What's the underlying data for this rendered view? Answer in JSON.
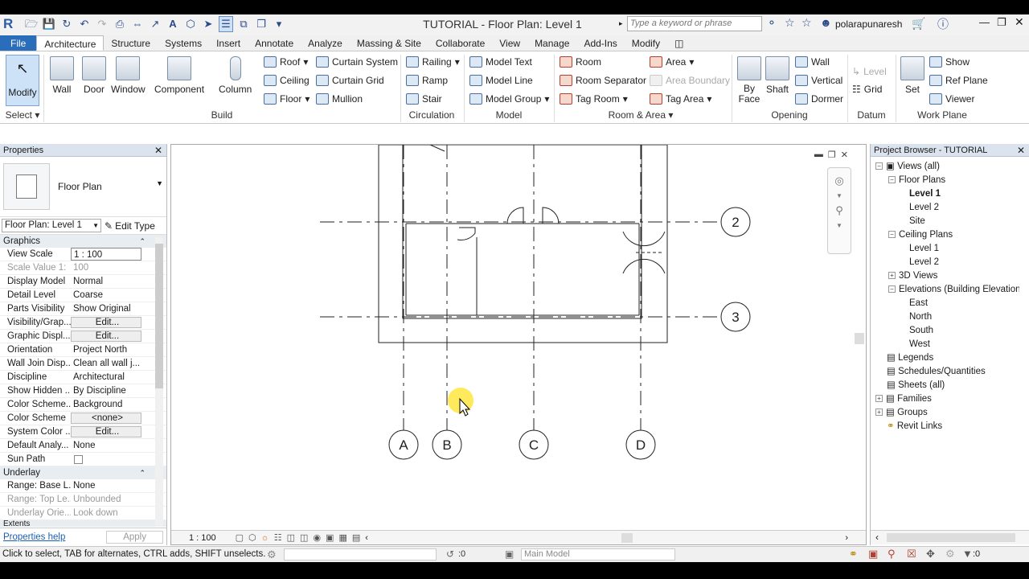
{
  "app": {
    "title": "TUTORIAL - Floor Plan: Level 1",
    "search_placeholder": "Type a keyword or phrase",
    "user": "polarapunaresh",
    "logo": "R"
  },
  "ribbon": {
    "tabs": [
      "File",
      "Architecture",
      "Structure",
      "Systems",
      "Insert",
      "Annotate",
      "Analyze",
      "Massing & Site",
      "Collaborate",
      "View",
      "Manage",
      "Add-Ins",
      "Modify"
    ],
    "select": {
      "modify": "Modify",
      "panel": "Select"
    },
    "build": {
      "wall": "Wall",
      "door": "Door",
      "window": "Window",
      "component": "Component",
      "column": "Column",
      "roof": "Roof",
      "ceiling": "Ceiling",
      "floor": "Floor",
      "curtain_system": "Curtain System",
      "curtain_grid": "Curtain Grid",
      "mullion": "Mullion",
      "panel": "Build"
    },
    "circulation": {
      "railing": "Railing",
      "ramp": "Ramp",
      "stair": "Stair",
      "panel": "Circulation"
    },
    "model": {
      "model_text": "Model Text",
      "model_line": "Model Line",
      "model_group": "Model Group",
      "panel": "Model"
    },
    "room_area": {
      "room": "Room",
      "room_separator": "Room Separator",
      "tag_room": "Tag Room",
      "area": "Area",
      "area_boundary": "Area Boundary",
      "tag_area": "Tag Area",
      "panel": "Room & Area"
    },
    "opening": {
      "by_face": "By",
      "by_face2": "Face",
      "shaft": "Shaft",
      "wall": "Wall",
      "vertical": "Vertical",
      "dormer": "Dormer",
      "panel": "Opening"
    },
    "datum": {
      "level": "Level",
      "grid": "Grid",
      "panel": "Datum"
    },
    "work_plane": {
      "set": "Set",
      "show": "Show",
      "ref_plane": "Ref Plane",
      "viewer": "Viewer",
      "panel": "Work Plane"
    }
  },
  "properties": {
    "title": "Properties",
    "type_name": "Floor Plan",
    "instance_select": "Floor Plan: Level 1",
    "edit_type": "Edit Type",
    "group_graphics": "Graphics",
    "rows": [
      {
        "key": "View Scale",
        "value": "1 : 100"
      },
      {
        "key": "Scale Value    1:",
        "value": "100"
      },
      {
        "key": "Display Model",
        "value": "Normal"
      },
      {
        "key": "Detail Level",
        "value": "Coarse"
      },
      {
        "key": "Parts Visibility",
        "value": "Show Original"
      },
      {
        "key": "Visibility/Grap...",
        "value": "Edit..."
      },
      {
        "key": "Graphic Displ...",
        "value": "Edit..."
      },
      {
        "key": "Orientation",
        "value": "Project North"
      },
      {
        "key": "Wall Join Disp...",
        "value": "Clean all wall j..."
      },
      {
        "key": "Discipline",
        "value": "Architectural"
      },
      {
        "key": "Show Hidden ...",
        "value": "By Discipline"
      },
      {
        "key": "Color Scheme...",
        "value": "Background"
      },
      {
        "key": "Color Scheme",
        "value": "<none>"
      },
      {
        "key": "System Color ...",
        "value": "Edit..."
      },
      {
        "key": "Default Analy...",
        "value": "None"
      },
      {
        "key": "Sun Path",
        "value": ""
      }
    ],
    "group_underlay": "Underlay",
    "underlay_rows": [
      {
        "key": "Range: Base L...",
        "value": "None"
      },
      {
        "key": "Range: Top Le...",
        "value": "Unbounded"
      },
      {
        "key": "Underlay Orie...",
        "value": "Look down"
      }
    ],
    "group_extents": "Extents",
    "help": "Properties help",
    "apply": "Apply"
  },
  "canvas": {
    "grids": {
      "vertical": [
        "A",
        "B",
        "C",
        "D"
      ],
      "horizontal": [
        "2",
        "3"
      ]
    },
    "scale": "1 : 100"
  },
  "browser": {
    "title": "Project Browser - TUTORIAL",
    "views_all": "Views (all)",
    "floor_plans": "Floor Plans",
    "fp_items": [
      "Level 1",
      "Level 2",
      "Site"
    ],
    "ceiling_plans": "Ceiling Plans",
    "cp_items": [
      "Level 1",
      "Level 2"
    ],
    "views_3d": "3D Views",
    "elevations": "Elevations (Building Elevation)",
    "el_items": [
      "East",
      "North",
      "South",
      "West"
    ],
    "legends": "Legends",
    "schedules": "Schedules/Quantities",
    "sheets": "Sheets (all)",
    "families": "Families",
    "groups": "Groups",
    "revit_links": "Revit Links"
  },
  "status": {
    "hint": "Click to select, TAB for alternates, CTRL adds, SHIFT unselects.",
    "zero": ":0",
    "model": "Main Model",
    "filter_zero": ":0"
  }
}
